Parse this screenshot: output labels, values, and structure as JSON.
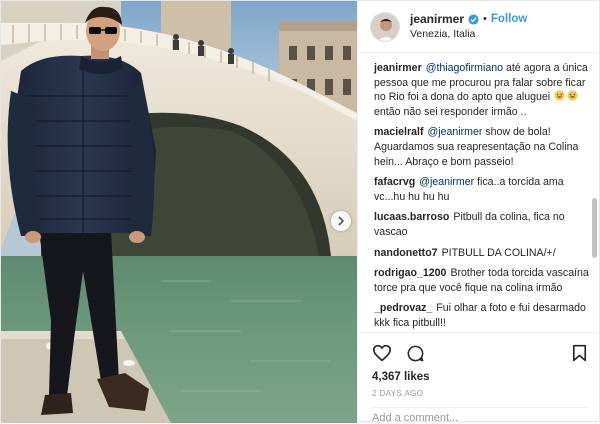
{
  "header": {
    "username": "jeanirmer",
    "separator": "•",
    "follow_label": "Follow",
    "location": "Venezia, Italia"
  },
  "caption": {
    "user": "jeanirmer",
    "mention": "@thiagofirmiano",
    "text_before_emoji": " até agora a única pessoa que me procurou pra falar sobre ficar no Rio foi a dona do apto que aluguei",
    "emojis": [
      "grinning-sweat-emoji",
      "grinning-sweat-emoji"
    ],
    "text_after_emoji": " então não sei responder irmão .."
  },
  "comments": [
    {
      "user": "macielralf",
      "mention": "@jeanirmer",
      "text": " show de bola! Aguardamos sua reapresentação na Colina hein... Abraço e bom passeio!"
    },
    {
      "user": "fafacrvg",
      "mention": "@jeanirmer",
      "text": " fica..a torcida ama vc...hu hu hu hu"
    },
    {
      "user": "lucaas.barroso",
      "mention": "",
      "text": "Pitbull da colina, fica no vascao"
    },
    {
      "user": "nandonetto7",
      "mention": "",
      "text": "PITBULL DA COLINA/+/"
    },
    {
      "user": "rodrigao_1200",
      "mention": "",
      "text": "Brother toda torcida vascaína torce pra que você fique na colina irmão"
    },
    {
      "user": "_pedrovaz_",
      "mention": "",
      "text": "Fui olhar a foto e fui desarmado kkk fica pitbull!!"
    }
  ],
  "actions": {
    "icons": [
      "heart-icon",
      "comment-icon",
      "bookmark-icon"
    ],
    "likes": "4,367 likes",
    "time_ago": "2 DAYS AGO",
    "add_comment_placeholder": "Add a comment..."
  },
  "colors": {
    "link_blue": "#3897f0",
    "mention_blue": "#003569",
    "text": "#262626",
    "muted": "#999999",
    "border": "#efefef"
  }
}
